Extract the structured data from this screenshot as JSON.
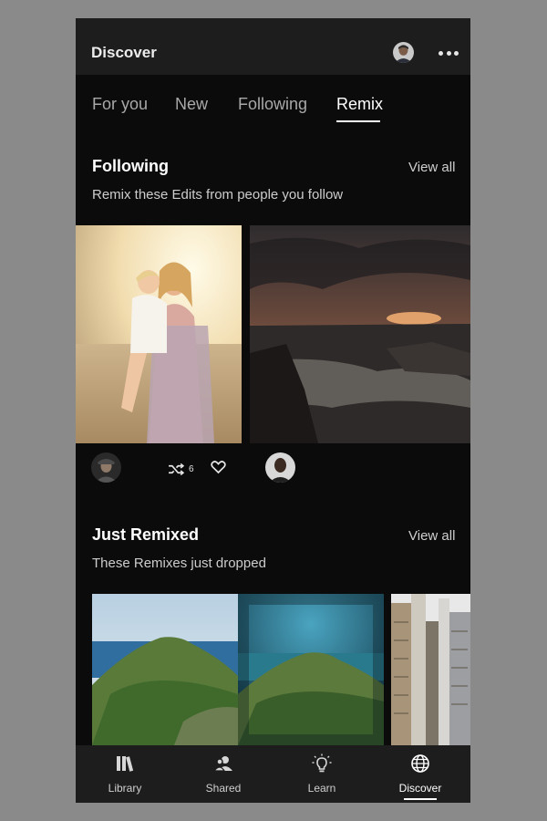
{
  "header": {
    "title": "Discover",
    "avatar_icon": "user-avatar-icon",
    "more_icon": "more-horizontal-icon"
  },
  "tabs": [
    {
      "label": "For you",
      "active": false
    },
    {
      "label": "New",
      "active": false
    },
    {
      "label": "Following",
      "active": false
    },
    {
      "label": "Remix",
      "active": true
    }
  ],
  "following": {
    "title": "Following",
    "view_all": "View all",
    "subtitle": "Remix these Edits from people you follow",
    "cards": [
      {
        "image": "mother-and-child-beach-photo",
        "remix_count": "6",
        "liked": false
      },
      {
        "image": "sunset-rocky-coast-photo"
      }
    ]
  },
  "just_remixed": {
    "title": "Just Remixed",
    "view_all": "View all",
    "subtitle": "These Remixes just dropped",
    "cards": [
      {
        "image": "island-hill-original-photo"
      },
      {
        "image": "island-hill-remixed-photo"
      },
      {
        "image": "city-buildings-photo"
      }
    ]
  },
  "bottom_nav": [
    {
      "label": "Library",
      "icon": "library-icon",
      "active": false
    },
    {
      "label": "Shared",
      "icon": "shared-icon",
      "active": false
    },
    {
      "label": "Learn",
      "icon": "lightbulb-icon",
      "active": false
    },
    {
      "label": "Discover",
      "icon": "globe-icon",
      "active": true
    }
  ],
  "colors": {
    "app_bar": "#1d1d1d",
    "background": "#0b0b0b",
    "active_text": "#ffffff",
    "inactive_text": "#a8a8a8"
  }
}
